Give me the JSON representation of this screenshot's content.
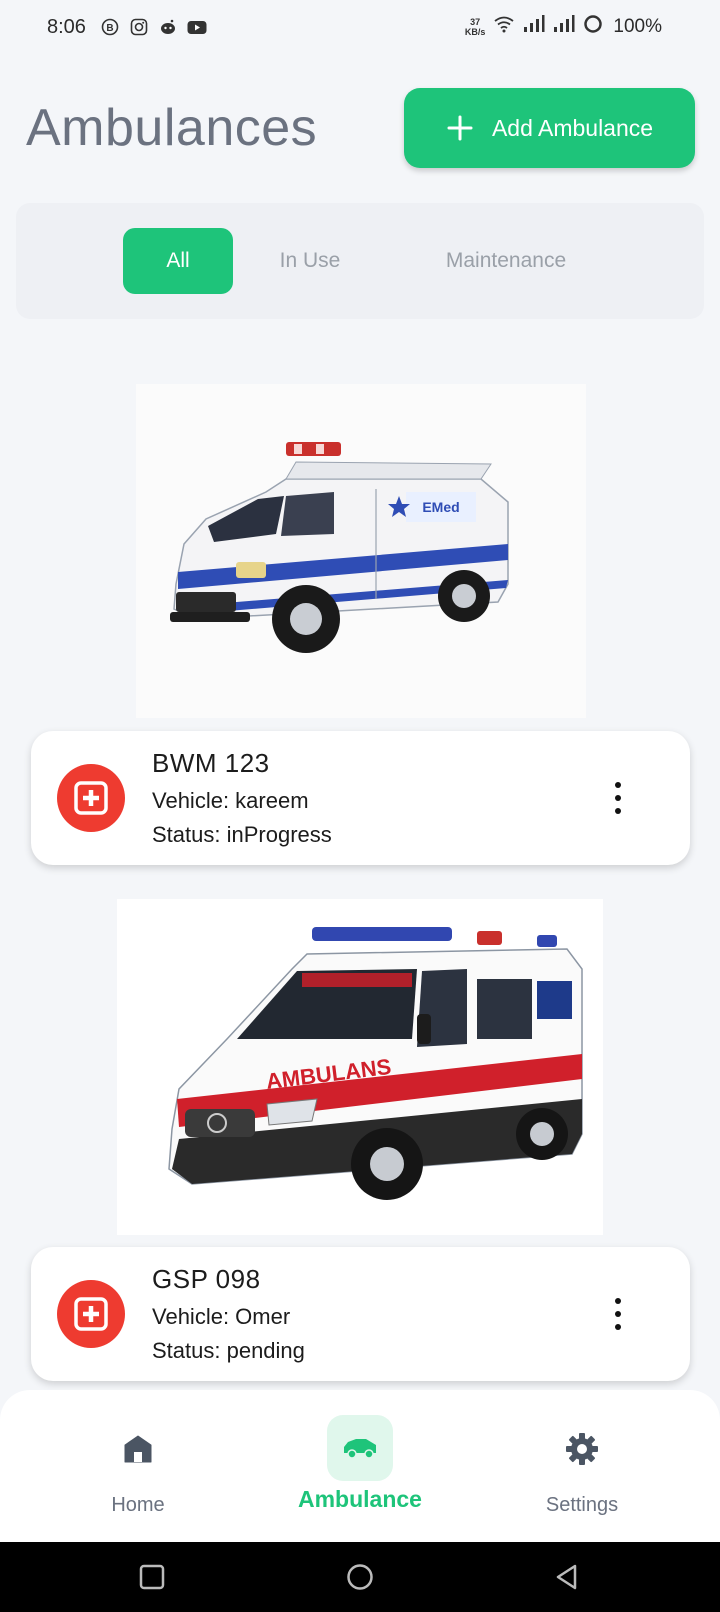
{
  "status_bar": {
    "time": "8:06",
    "net_speed_value": "37",
    "net_speed_unit": "KB/s",
    "battery": "100%",
    "app_icons": [
      "b-icon",
      "instagram-icon",
      "reddit-icon",
      "youtube-icon"
    ]
  },
  "header": {
    "title": "Ambulances",
    "add_button_label": "Add Ambulance"
  },
  "filters": {
    "tabs": [
      {
        "label": "All",
        "active": true
      },
      {
        "label": "In Use",
        "active": false
      },
      {
        "label": "Maintenance",
        "active": false
      }
    ]
  },
  "ambulances": [
    {
      "plate": "BWM 123",
      "vehicle": "Vehicle: kareem",
      "status": "Status: inProgress",
      "icon": "medical-cross-icon"
    },
    {
      "plate": "GSP 098",
      "vehicle": "Vehicle: Omer",
      "status": "Status: pending",
      "icon": "medical-cross-icon"
    }
  ],
  "bottom_nav": {
    "items": [
      {
        "label": "Home",
        "icon": "home-icon",
        "active": false
      },
      {
        "label": "Ambulance",
        "icon": "ambulance-icon",
        "active": true
      },
      {
        "label": "Settings",
        "icon": "gear-icon",
        "active": false
      }
    ]
  },
  "colors": {
    "accent": "#1ec47a",
    "danger": "#ee3b30",
    "title": "#6b7280"
  }
}
